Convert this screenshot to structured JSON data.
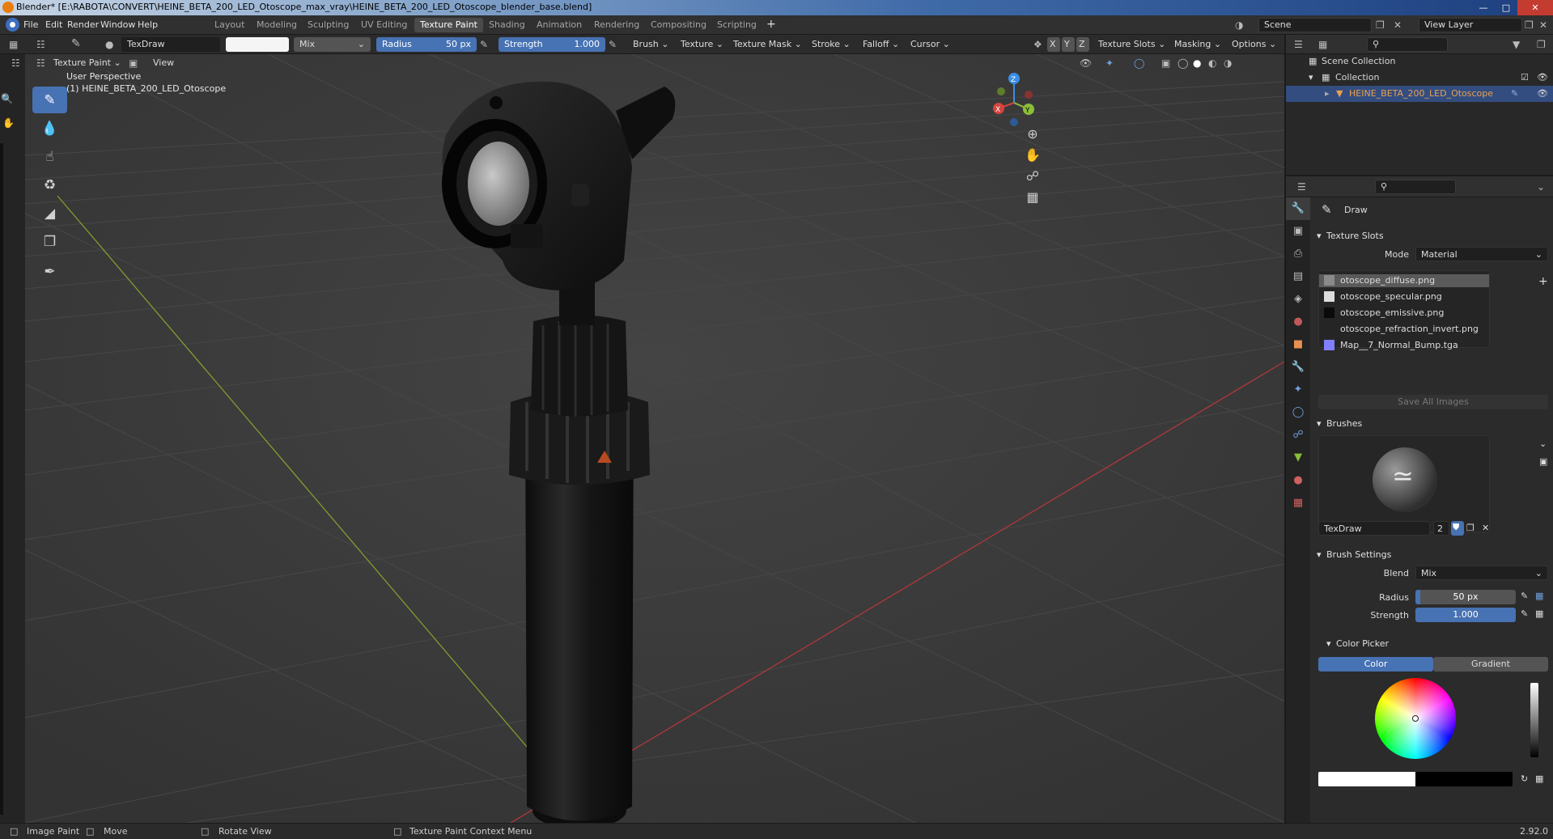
{
  "window": {
    "title": "Blender* [E:\\RABOTA\\CONVERT\\HEINE_BETA_200_LED_Otoscope_max_vray\\HEINE_BETA_200_LED_Otoscope_blender_base.blend]"
  },
  "menu": [
    "File",
    "Edit",
    "Render",
    "Window",
    "Help"
  ],
  "workspaces": [
    {
      "label": "Layout",
      "active": false
    },
    {
      "label": "Modeling",
      "active": false
    },
    {
      "label": "Sculpting",
      "active": false
    },
    {
      "label": "UV Editing",
      "active": false
    },
    {
      "label": "Texture Paint",
      "active": true
    },
    {
      "label": "Shading",
      "active": false
    },
    {
      "label": "Animation",
      "active": false
    },
    {
      "label": "Rendering",
      "active": false
    },
    {
      "label": "Compositing",
      "active": false
    },
    {
      "label": "Scripting",
      "active": false
    }
  ],
  "add_workspace": "+",
  "scene": {
    "label": "Scene",
    "view_layer": "View Layer"
  },
  "toolheader": {
    "brush_name": "TexDraw",
    "blend": "Mix",
    "radius_label": "Radius",
    "radius_value": "50 px",
    "strength_label": "Strength",
    "strength_value": "1.000",
    "menus": [
      "Brush",
      "Texture",
      "Texture Mask",
      "Stroke",
      "Falloff",
      "Cursor"
    ],
    "axes": [
      "X",
      "Y",
      "Z"
    ],
    "right_menus": [
      "Texture Slots",
      "Masking",
      "Options"
    ]
  },
  "viewheader": {
    "mode": "Texture Paint",
    "view": "View"
  },
  "viewport": {
    "perspective": "User Perspective",
    "object": "(1) HEINE_BETA_200_LED_Otoscope",
    "gizmo": {
      "x": "X",
      "y": "Y",
      "z": "Z"
    }
  },
  "outliner": {
    "scene_collection": "Scene Collection",
    "collection": "Collection",
    "object": "HEINE_BETA_200_LED_Otoscope"
  },
  "properties": {
    "tool": "Draw",
    "texture_slots": {
      "title": "Texture Slots",
      "mode_label": "Mode",
      "mode_value": "Material",
      "slots": [
        {
          "name": "otoscope_diffuse.png",
          "swatch": "#8a8a8a",
          "selected": true
        },
        {
          "name": "otoscope_specular.png",
          "swatch": "#dcdcdc",
          "selected": false
        },
        {
          "name": "otoscope_emissive.png",
          "swatch": "#0a0a0a",
          "selected": false
        },
        {
          "name": "otoscope_refraction_invert.png",
          "swatch": "",
          "selected": false
        },
        {
          "name": "Map__7_Normal_Bump.tga",
          "swatch": "#8080ff",
          "selected": false
        }
      ],
      "save_all": "Save All Images"
    },
    "brushes": {
      "title": "Brushes",
      "name": "TexDraw",
      "users": "2"
    },
    "brush_settings": {
      "title": "Brush Settings",
      "blend_label": "Blend",
      "blend_value": "Mix",
      "radius_label": "Radius",
      "radius_value": "50 px",
      "strength_label": "Strength",
      "strength_value": "1.000"
    },
    "color_picker": {
      "title": "Color Picker",
      "tab_color": "Color",
      "tab_gradient": "Gradient"
    }
  },
  "statusbar": {
    "image_paint": "Image Paint",
    "move": "Move",
    "rotate": "Rotate View",
    "context": "Texture Paint Context Menu",
    "version": "2.92.0"
  },
  "colors": {
    "accent": "#4772b3",
    "x_axis": "#d7443f",
    "y_axis": "#8cbe3a",
    "z_axis": "#3a8ee6",
    "object_highlight": "#e8a050"
  }
}
